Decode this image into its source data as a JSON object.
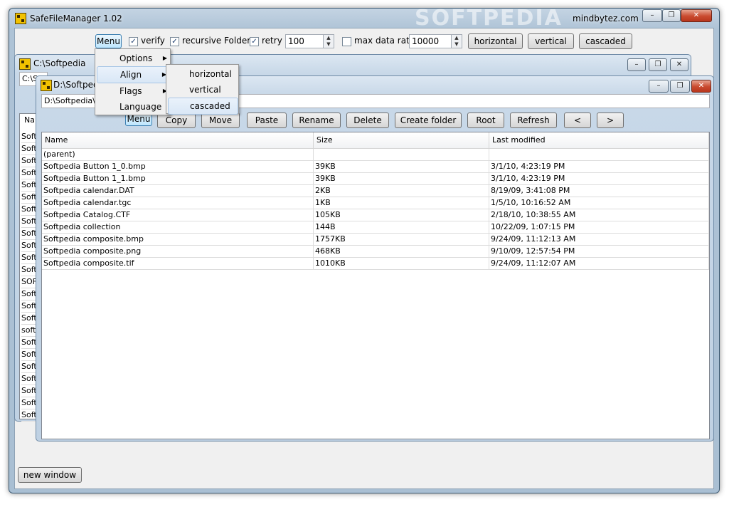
{
  "app": {
    "title": "SafeFileManager 1.02",
    "website": "mindbytez.com",
    "watermark": "SOFTPEDIA",
    "caption_minimize": "–",
    "caption_restore": "❐",
    "caption_close": "✕"
  },
  "toolbar": {
    "menu_label": "Menu",
    "verify_label": "verify",
    "verify_checked": "✓",
    "recursive_label": "recursive Folders",
    "recursive_checked": "✓",
    "retry_label": "retry",
    "retry_checked": "✓",
    "retry_value": "100",
    "max_rate_label": "max data rate",
    "max_rate_checked": "",
    "max_rate_value": "10000",
    "horizontal": "horizontal",
    "vertical": "vertical",
    "cascaded": "cascaded"
  },
  "menu": {
    "items": [
      {
        "label": "Options",
        "arrow": "▶"
      },
      {
        "label": "Align",
        "arrow": "▶"
      },
      {
        "label": "Flags",
        "arrow": "▶"
      },
      {
        "label": "Language",
        "arrow": ""
      }
    ],
    "align_submenu": [
      "horizontal",
      "vertical",
      "cascaded"
    ]
  },
  "window_c": {
    "title": "C:\\Softpedia",
    "path": "C:\\S",
    "header_fragment": "Nar",
    "row_fragments": [
      "Soft",
      "Soft",
      "Soft",
      "Soft",
      "Soft",
      "Soft",
      "Soft",
      "Soft",
      "Soft",
      "Soft",
      "Soft",
      "Soft",
      "SOF",
      "Soft",
      "Soft",
      "Soft",
      "soft",
      "Soft",
      "Soft",
      "Soft",
      "Soft",
      "Soft",
      "Soft",
      "Soft"
    ]
  },
  "window_d": {
    "title": "D:\\Softpedia",
    "path": "D:\\Softpedia\\So",
    "toolbar": {
      "menu": "Menu",
      "copy": "Copy",
      "move": "Move",
      "paste": "Paste",
      "rename": "Rename",
      "delete": "Delete",
      "create_folder": "Create folder",
      "root": "Root",
      "refresh": "Refresh",
      "back": "<",
      "forward": ">"
    },
    "columns": [
      "Name",
      "Size",
      "Last modified"
    ],
    "rows": [
      {
        "name": "(parent)",
        "size": "",
        "modified": ""
      },
      {
        "name": "Softpedia Button 1_0.bmp",
        "size": "39KB",
        "modified": "3/1/10,  4:23:19 PM"
      },
      {
        "name": "Softpedia Button 1_1.bmp",
        "size": "39KB",
        "modified": "3/1/10,  4:23:19 PM"
      },
      {
        "name": "Softpedia calendar.DAT",
        "size": "2KB",
        "modified": "8/19/09,  3:41:08 PM"
      },
      {
        "name": "Softpedia calendar.tgc",
        "size": "1KB",
        "modified": "1/5/10,  10:16:52 AM"
      },
      {
        "name": "Softpedia Catalog.CTF",
        "size": "105KB",
        "modified": "2/18/10,  10:38:55 AM"
      },
      {
        "name": "Softpedia collection",
        "size": "144B",
        "modified": "10/22/09,  1:07:15 PM"
      },
      {
        "name": "Softpedia composite.bmp",
        "size": "1757KB",
        "modified": "9/24/09,  11:12:13 AM"
      },
      {
        "name": "Softpedia composite.png",
        "size": "468KB",
        "modified": "9/10/09,  12:57:54 PM"
      },
      {
        "name": "Softpedia composite.tif",
        "size": "1010KB",
        "modified": "9/24/09,  11:12:07 AM"
      }
    ]
  },
  "footer": {
    "new_window": "new window"
  }
}
